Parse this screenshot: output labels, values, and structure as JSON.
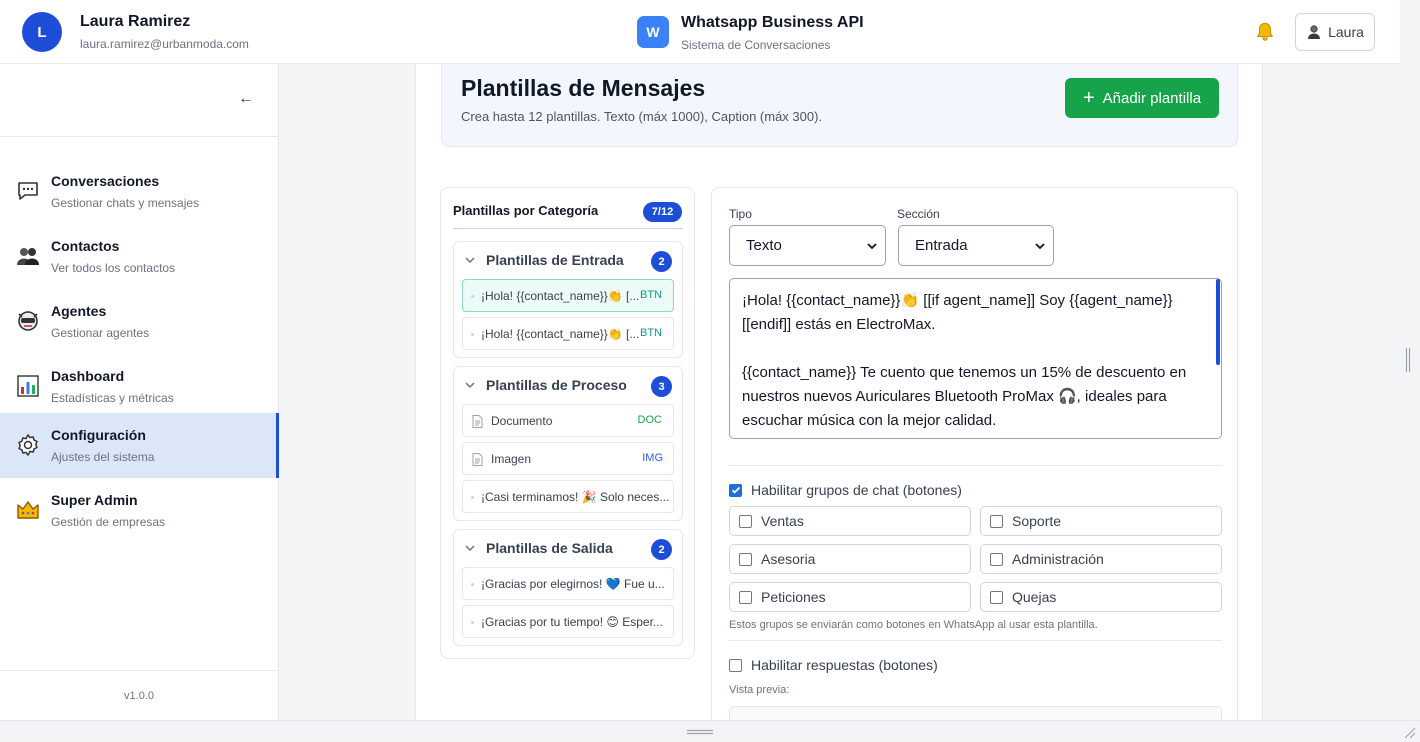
{
  "user": {
    "initial": "L",
    "name": "Laura Ramirez",
    "email": "laura.ramirez@urbanmoda.com"
  },
  "app": {
    "logo_letter": "W",
    "title": "Whatsapp Business API",
    "subtitle": "Sistema de Conversaciones"
  },
  "topbar": {
    "user_button_label": "Laura",
    "icons": [
      "bell-icon",
      "user-icon"
    ]
  },
  "sidebar": {
    "collapse_label": "←",
    "items": [
      {
        "title": "Conversaciones",
        "subtitle": "Gestionar chats y mensajes",
        "icon": "chat-icon",
        "active": false
      },
      {
        "title": "Contactos",
        "subtitle": "Ver todos los contactos",
        "icon": "people-icon",
        "active": false
      },
      {
        "title": "Agentes",
        "subtitle": "Gestionar agentes",
        "icon": "agent-icon",
        "active": false
      },
      {
        "title": "Dashboard",
        "subtitle": "Estadísticas y métricas",
        "icon": "chart-icon",
        "active": false
      },
      {
        "title": "Configuración",
        "subtitle": "Ajustes del sistema",
        "icon": "gear-icon",
        "active": true
      },
      {
        "title": "Super Admin",
        "subtitle": "Gestión de empresas",
        "icon": "crown-icon",
        "active": false
      }
    ],
    "version": "v1.0.0"
  },
  "header": {
    "title": "Plantillas de Mensajes",
    "subtitle": "Crea hasta 12 plantillas. Texto (máx 1000), Caption (máx 300).",
    "add_label": "Añadir plantilla"
  },
  "categories": {
    "title": "Plantillas por Categoría",
    "count": "7/12",
    "groups": [
      {
        "title": "Plantillas de Entrada",
        "count": "2",
        "items": [
          {
            "text": "¡Hola! {{contact_name}}👏 [...",
            "tag": "BTN",
            "selected": true
          },
          {
            "text": "¡Hola! {{contact_name}}👏 [...",
            "tag": "BTN",
            "selected": false
          }
        ]
      },
      {
        "title": "Plantillas de Proceso",
        "count": "3",
        "items": [
          {
            "text": "Documento",
            "tag": "DOC",
            "icon": "document-icon"
          },
          {
            "text": "Imagen",
            "tag": "IMG",
            "icon": "document-icon"
          },
          {
            "text": "¡Casi terminamos! 🎉 Solo neces...",
            "tag": ""
          }
        ]
      },
      {
        "title": "Plantillas de Salida",
        "count": "2",
        "items": [
          {
            "text": "¡Gracias por elegirnos! 💙 Fue u...",
            "tag": ""
          },
          {
            "text": "¡Gracias por tu tiempo! 😊 Esper...",
            "tag": ""
          }
        ]
      }
    ]
  },
  "editor": {
    "type_label": "Tipo",
    "type_value": "Texto",
    "section_label": "Sección",
    "section_value": "Entrada",
    "message": "¡Hola! {{contact_name}}👏 [[if agent_name]] Soy {{agent_name}} [[endif]] estás en ElectroMax.\n\n{{contact_name}} Te cuento que tenemos un 15% de descuento en nuestros nuevos Auriculares Bluetooth ProMax 🎧, ideales para escuchar música con la mejor calidad.",
    "enable_groups_label": "Habilitar grupos de chat (botones)",
    "enable_groups_checked": true,
    "groups": [
      {
        "label": "Ventas",
        "checked": false
      },
      {
        "label": "Soporte",
        "checked": false
      },
      {
        "label": "Asesoria",
        "checked": false
      },
      {
        "label": "Administración",
        "checked": false
      },
      {
        "label": "Peticiones",
        "checked": false
      },
      {
        "label": "Quejas",
        "checked": false
      }
    ],
    "groups_hint": "Estos grupos se enviarán como botones en WhatsApp al usar esta plantilla.",
    "enable_replies_label": "Habilitar respuestas (botones)",
    "enable_replies_checked": false,
    "preview_label": "Vista previa:"
  },
  "colors": {
    "primary": "#1d4ed8",
    "success": "#16a34a",
    "accent_teal": "#0e9a8c"
  }
}
